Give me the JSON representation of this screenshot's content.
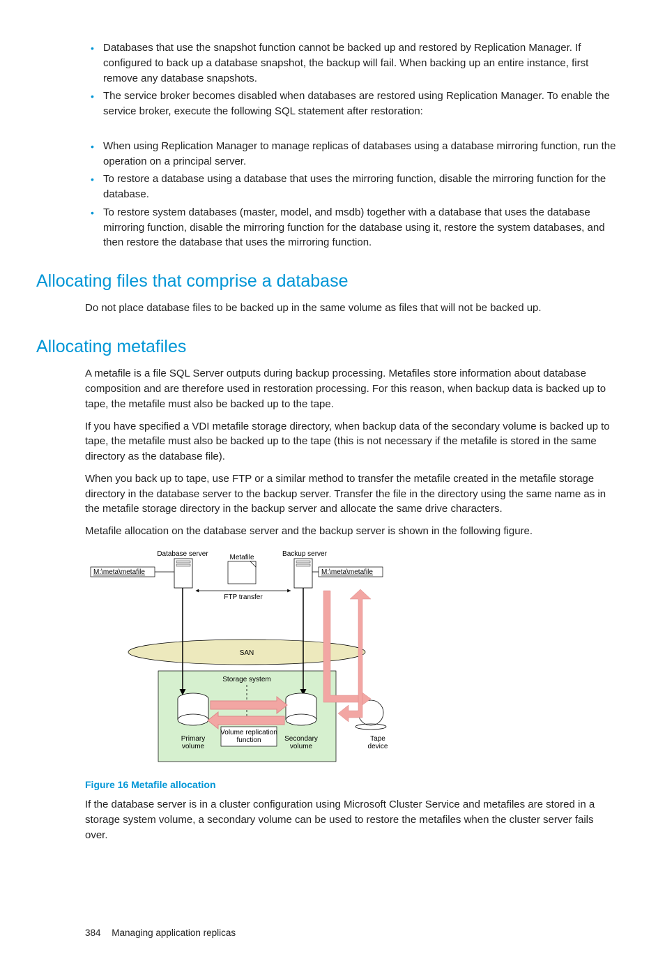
{
  "bullets1": [
    "Databases that use the snapshot function cannot be backed up and restored by Replication Manager. If configured to back up a database snapshot, the backup will fail. When backing up an entire instance, first remove any database snapshots.",
    "The service broker becomes disabled when databases are restored using Replication Manager. To enable the service broker, execute the following SQL statement after restoration:"
  ],
  "bullets2": [
    "When using Replication Manager to manage replicas of databases using a database mirroring function, run the operation on a principal server.",
    "To restore a database using a database that uses the mirroring function, disable the mirroring function for the database.",
    "To restore system databases (master, model, and msdb) together with a database that uses the database mirroring function, disable the mirroring function for the database using it, restore the system databases, and then restore the database that uses the mirroring function."
  ],
  "h_alloc_files": "Allocating files that comprise a database",
  "p_alloc_files": "Do not place database files to be backed up in the same volume as files that will not be backed up.",
  "h_alloc_meta": "Allocating metafiles",
  "p_meta1": "A metafile is a file SQL Server outputs during backup processing. Metafiles store information about database composition and are therefore used in restoration processing. For this reason, when backup data is backed up to tape, the metafile must also be backed up to the tape.",
  "p_meta2": "If you have specified a VDI metafile storage directory, when backup data of the secondary volume is backed up to tape, the metafile must also be backed up to the tape (this is not necessary if the metafile is stored in the same directory as the database file).",
  "p_meta3": "When you back up to tape, use FTP or a similar method to transfer the metafile created in the metafile storage directory in the database server to the backup server. Transfer the file in the directory using the same name as in the metafile storage directory in the backup server and allocate the same drive characters.",
  "p_meta4": "Metafile allocation on the database server and the backup server is shown in the following figure.",
  "figure_caption": "Figure 16 Metafile allocation",
  "p_after_fig": "If the database server is in a cluster configuration using Microsoft Cluster Service and metafiles are stored in a storage system volume, a secondary volume can be used to restore the metafiles when the cluster server fails over.",
  "page_number": "384",
  "footer_text": "Managing application replicas",
  "diagram": {
    "db_server": "Database server",
    "backup_server": "Backup server",
    "metafile": "Metafile",
    "path": "M:\\meta\\metafile",
    "ftp": "FTP transfer",
    "san": "SAN",
    "storage": "Storage system",
    "primary": "Primary\nvolume",
    "replication": "Volume replication\nfunction",
    "secondary": "Secondary\nvolume",
    "tape": "Tape\ndevice"
  }
}
